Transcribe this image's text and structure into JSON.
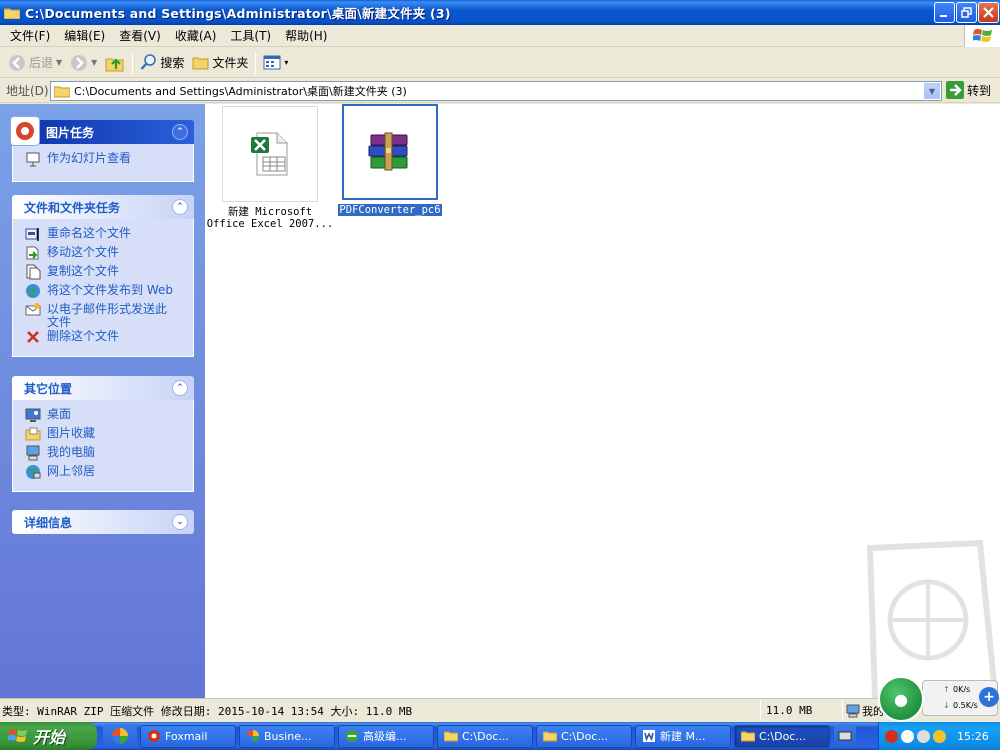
{
  "window": {
    "title": "C:\\Documents and Settings\\Administrator\\桌面\\新建文件夹 (3)"
  },
  "menu": [
    {
      "label": "文件(F)"
    },
    {
      "label": "编辑(E)"
    },
    {
      "label": "查看(V)"
    },
    {
      "label": "收藏(A)"
    },
    {
      "label": "工具(T)"
    },
    {
      "label": "帮助(H)"
    }
  ],
  "toolbar": {
    "back_label": "后退",
    "search_label": "搜索",
    "folders_label": "文件夹"
  },
  "address": {
    "label": "地址(D)",
    "value": "C:\\Documents and Settings\\Administrator\\桌面\\新建文件夹 (3)",
    "go_label": "转到"
  },
  "taskpane": {
    "picture_tasks": {
      "title": "图片任务",
      "items": [
        {
          "label": "作为幻灯片查看",
          "icon": "slideshow-icon"
        }
      ]
    },
    "file_tasks": {
      "title": "文件和文件夹任务",
      "items": [
        {
          "label": "重命名这个文件",
          "icon": "rename-icon"
        },
        {
          "label": "移动这个文件",
          "icon": "move-icon"
        },
        {
          "label": "复制这个文件",
          "icon": "copy-icon"
        },
        {
          "label": "将这个文件发布到 Web",
          "icon": "publish-web-icon"
        },
        {
          "label": "以电子邮件形式发送此文件",
          "icon": "email-icon"
        },
        {
          "label": "删除这个文件",
          "icon": "delete-icon"
        }
      ]
    },
    "other_places": {
      "title": "其它位置",
      "items": [
        {
          "label": "桌面",
          "icon": "desktop-icon"
        },
        {
          "label": "图片收藏",
          "icon": "my-pictures-icon"
        },
        {
          "label": "我的电脑",
          "icon": "my-computer-icon"
        },
        {
          "label": "网上邻居",
          "icon": "network-icon"
        }
      ]
    },
    "details": {
      "title": "详细信息"
    }
  },
  "files": [
    {
      "name_line1": "新建 Microsoft",
      "name_line2": "Office Excel 2007...",
      "icon": "excel-file-icon",
      "selected": false
    },
    {
      "name_line1": "PDFConverter_pc6",
      "name_line2": "",
      "icon": "winrar-archive-icon",
      "selected": true
    }
  ],
  "status": {
    "text": "类型: WinRAR ZIP 压缩文件 修改日期: 2015-10-14 13:54 大小: 11.0 MB",
    "size": "11.0 MB",
    "zone": "我的"
  },
  "netspeed": {
    "up": "0K/s",
    "down": "0.5K/s"
  },
  "taskbar": {
    "start_label": "开始",
    "tasks": [
      {
        "label": "Foxmail",
        "icon": "foxmail-icon",
        "active": false
      },
      {
        "label": "Busine...",
        "icon": "app-icon",
        "active": false
      },
      {
        "label": "高级编...",
        "icon": "browser-icon",
        "active": false
      },
      {
        "label": "C:\\Doc...",
        "icon": "folder-icon",
        "active": false
      },
      {
        "label": "C:\\Doc...",
        "icon": "folder-icon",
        "active": false
      },
      {
        "label": "新建 M...",
        "icon": "word-icon",
        "active": false
      },
      {
        "label": "C:\\Doc...",
        "icon": "folder-icon",
        "active": true
      }
    ],
    "clock": "15:26"
  },
  "colors": {
    "titlebar": "#0a58d0",
    "taskpane_link": "#215dc6",
    "selection": "#316ac5",
    "start_green": "#48a548"
  }
}
